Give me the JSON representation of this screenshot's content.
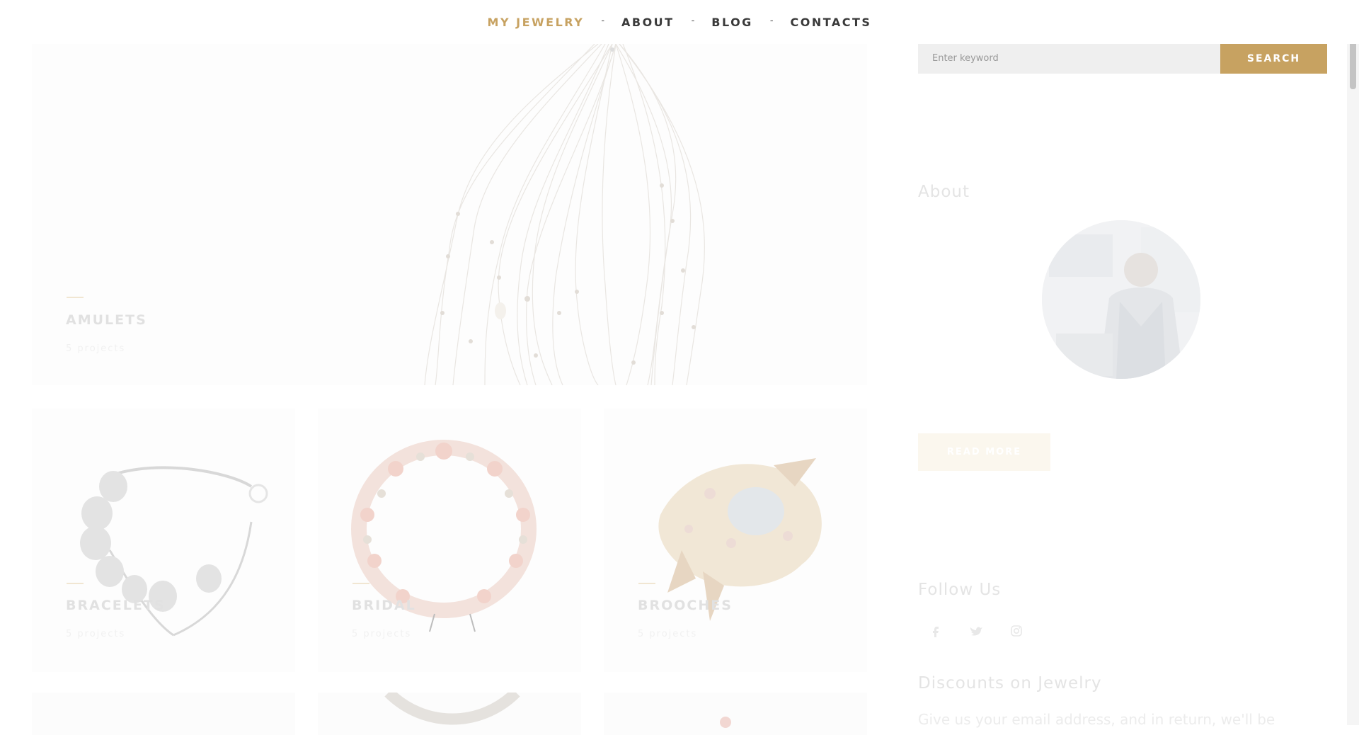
{
  "nav": {
    "items": [
      {
        "label": "MY JEWELRY",
        "active": true
      },
      {
        "label": "ABOUT"
      },
      {
        "label": "BLOG"
      },
      {
        "label": "CONTACTS"
      }
    ],
    "separator": "-",
    "accent_color": "#c7a261"
  },
  "categories": [
    {
      "title": "AMULETS",
      "count": "5 projects"
    },
    {
      "title": "BRACELETS",
      "count": "5 projects"
    },
    {
      "title": "BRIDAL",
      "count": "5 projects"
    },
    {
      "title": "BROOCHES",
      "count": "5 projects"
    }
  ],
  "sidebar": {
    "search": {
      "placeholder": "Enter keyword",
      "button": "SEARCH"
    },
    "about": {
      "title": "About",
      "read_more": "READ MORE"
    },
    "follow": {
      "title": "Follow Us",
      "icons": [
        "facebook-icon",
        "twitter-icon",
        "instagram-icon"
      ]
    },
    "discounts": {
      "title": "Discounts on Jewelry",
      "text": "Give us your email address, and in return, we'll be"
    }
  }
}
